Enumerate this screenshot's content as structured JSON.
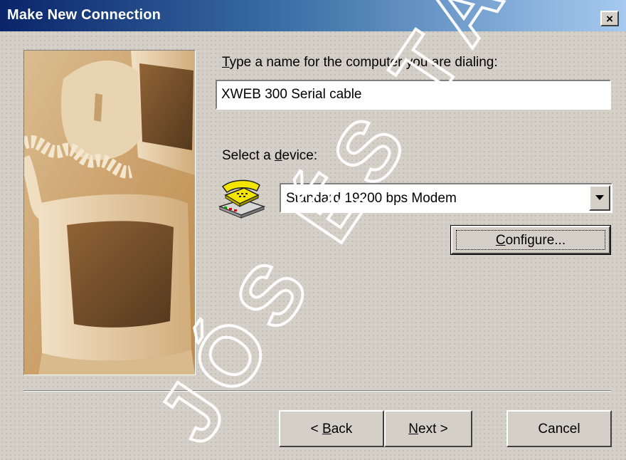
{
  "window": {
    "title": "Make New Connection",
    "close_glyph": "×"
  },
  "name_prompt": {
    "before": "",
    "accel": "T",
    "after": "ype a name for the computer you are dialing:"
  },
  "name_value": "XWEB 300 Serial cable",
  "device_prompt": {
    "before": "Select a ",
    "accel": "d",
    "after": "evice:"
  },
  "device_selected": "Standard 19200 bps Modem",
  "configure": {
    "before": "",
    "accel": "C",
    "after": "onfigure..."
  },
  "back": {
    "before": "< ",
    "accel": "B",
    "after": "ack"
  },
  "next": {
    "before": "",
    "accel": "N",
    "after": "ext >"
  },
  "cancel": "Cancel",
  "watermark": "JÓS ÉS TÁRSA",
  "icons": {
    "close": "close-icon",
    "dropdown": "chevron-down-icon",
    "device": "modem-phone-icon",
    "illustration": "computers-illustration"
  },
  "colors": {
    "title_bar_start": "#0a246a",
    "title_bar_end": "#a6caf0",
    "dialog_face": "#d4d0c8",
    "illustration_tone": "#c8a066"
  }
}
